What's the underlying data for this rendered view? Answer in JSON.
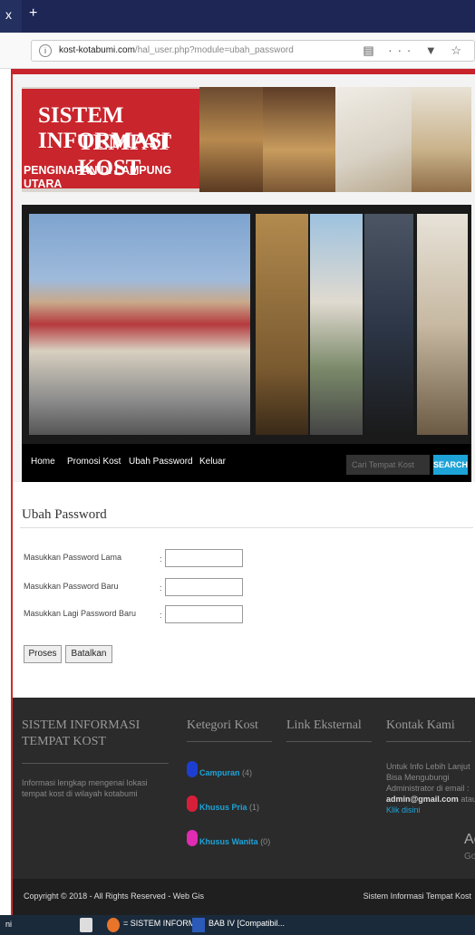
{
  "browser": {
    "tab_close": "x",
    "tab_new": "+",
    "url_host": "kost-kotabumi.com",
    "url_path": "/hal_user.php?module=ubah_password",
    "url_info": "i",
    "icons": "▤ ··· ▼ ☆"
  },
  "banner": {
    "line1": "SISTEM INFORMASI",
    "line2": "TEMPAT KOST",
    "line3": "PENGINAPAN DI LAMPUNG UTARA"
  },
  "menu": {
    "items": [
      "Home",
      "Promosi Kost",
      "Ubah Password",
      "Keluar"
    ],
    "search_placeholder": "Cari Tempat Kost",
    "search_button": "SEARCH"
  },
  "content": {
    "title": "Ubah Password",
    "fields": [
      {
        "label": "Masukkan Password Lama",
        "value": ""
      },
      {
        "label": "Masukkan Password Baru",
        "value": ""
      },
      {
        "label": "Masukkan Lagi Password Baru",
        "value": ""
      }
    ],
    "colon": ":",
    "buttons": {
      "submit": "Proses",
      "cancel": "Batalkan"
    }
  },
  "footer": {
    "col1": {
      "title": "SISTEM INFORMASI TEMPAT KOST",
      "text": "Informasi lengkap mengenai lokasi tempat kost di wilayah kotabumi"
    },
    "col2": {
      "title": "Ketegori Kost",
      "categories": [
        {
          "name": "Campuran",
          "count": "(4)",
          "color": "#1d3fd1"
        },
        {
          "name": "Khusus Pria",
          "count": "(1)",
          "color": "#d81f3a"
        },
        {
          "name": "Khusus Wanita",
          "count": "(0)",
          "color": "#e02bb3"
        }
      ]
    },
    "col3": {
      "title": "Link Eksternal"
    },
    "col4": {
      "title": "Kontak Kami",
      "line1": "Untuk Info Lebih Lanjut",
      "line2": "Bisa Mengubungi",
      "line3": "Administrator di email :",
      "email": "admin@gmail.com",
      "atau": "atau",
      "link": "Klik disini"
    },
    "ghost1": "Ac",
    "ghost2": "Go"
  },
  "copyright": {
    "left": "Copyright © 2018 - All Rights Reserved - Web Gis",
    "right": "Sistem Informasi Tempat Kost"
  },
  "taskbar": {
    "edge_text": "ni",
    "item1": "= SISTEM INFORM...",
    "item2": "BAB IV [Compatibil..."
  }
}
